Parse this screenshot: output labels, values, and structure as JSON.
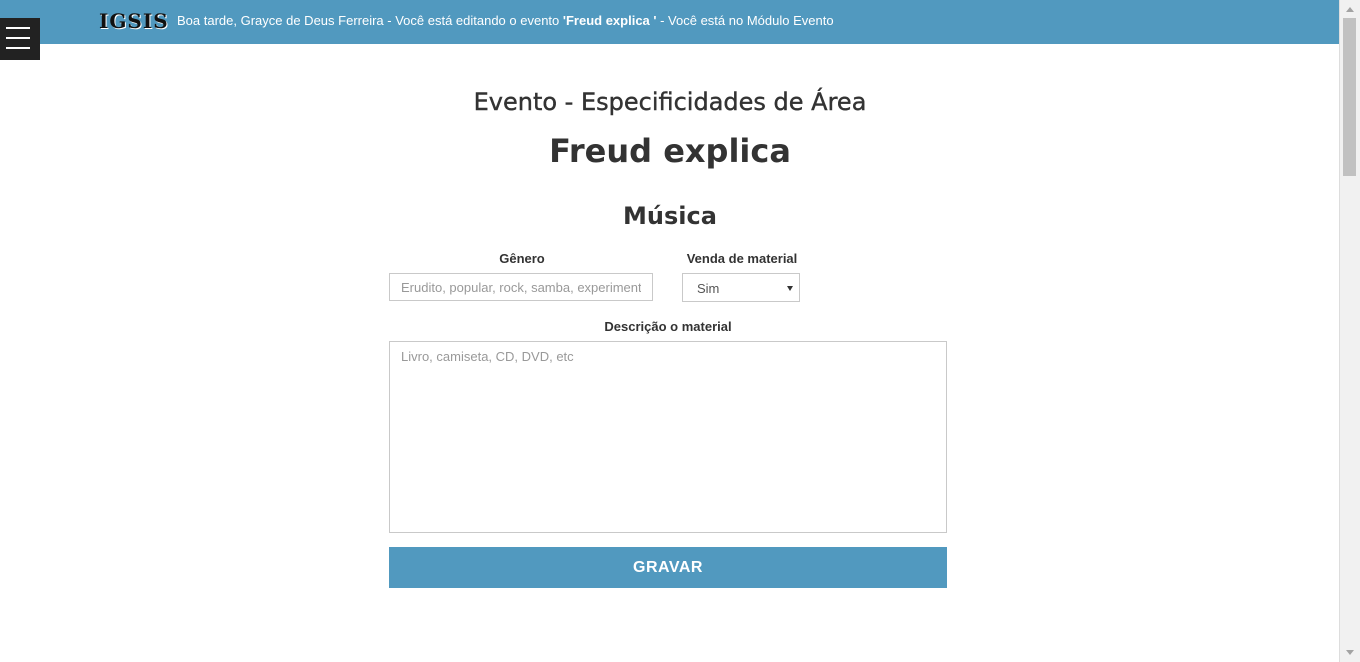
{
  "header": {
    "brand": "IGSIS",
    "greeting_prefix": "Boa tarde, Grayce de Deus Ferreira - Você está editando o evento ",
    "event_name_quoted": "'Freud explica '",
    "greeting_suffix": " - Você está no Módulo Evento"
  },
  "icons": {
    "menu": "hamburger-menu-icon",
    "select_caret": "caret-down-icon"
  },
  "colors": {
    "accent": "#5199bf",
    "menu_bg": "#222222",
    "text": "#333333"
  },
  "page": {
    "section_title": "Evento - Especificidades de Área",
    "event_title": "Freud explica",
    "area_title": "Música"
  },
  "form": {
    "genero": {
      "label": "Gênero",
      "value": "",
      "placeholder": "Erudito, popular, rock, samba, experimental"
    },
    "venda": {
      "label": "Venda de material",
      "selected": "Sim"
    },
    "descricao": {
      "label": "Descrição o material",
      "value": "",
      "placeholder": "Livro, camiseta, CD, DVD, etc"
    },
    "submit_label": "GRAVAR"
  }
}
